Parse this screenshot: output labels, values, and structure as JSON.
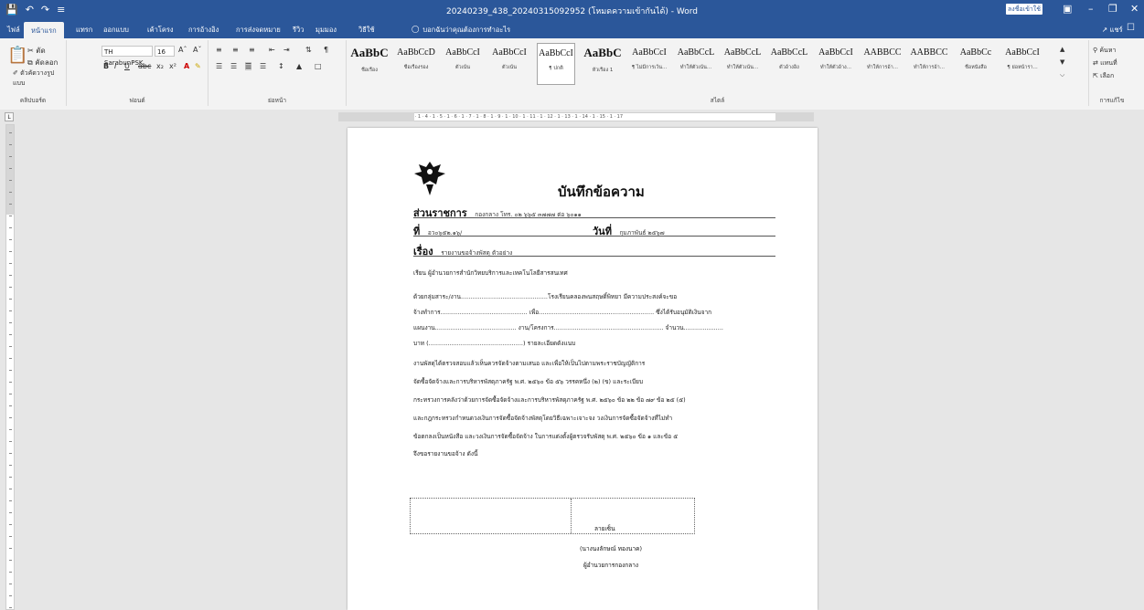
{
  "window": {
    "title": "20240239_438_20240315092952 (โหมดความเข้ากันได้) - Word",
    "signin_label": "ลงชื่อเข้าใช้",
    "save_icon": "save-icon",
    "undo_icon": "undo-icon",
    "redo_icon": "redo-icon"
  },
  "tabs": [
    {
      "label": "ไฟล์"
    },
    {
      "label": "หน้าแรก",
      "active": true
    },
    {
      "label": "แทรก"
    },
    {
      "label": "ออกแบบ"
    },
    {
      "label": "เค้าโครง"
    },
    {
      "label": "การอ้างอิง"
    },
    {
      "label": "การส่งจดหมาย"
    },
    {
      "label": "รีวิว"
    },
    {
      "label": "มุมมอง"
    },
    {
      "label": "วิธีใช้"
    }
  ],
  "tell_me": "บอกฉันว่าคุณต้องการทำอะไร",
  "share_label": "แชร์",
  "ribbon": {
    "clipboard": {
      "cut": "ตัด",
      "copy": "คัดลอก",
      "painter": "ตัวคัดวางรูปแบบ",
      "label": "คลิปบอร์ด"
    },
    "font": {
      "name": "TH SarabunPSK",
      "size": "16",
      "label": "ฟอนต์"
    },
    "paragraph": {
      "label": "ย่อหน้า"
    },
    "styles": {
      "label": "สไตล์",
      "items": [
        {
          "sample": "AaBbC",
          "name": "ชื่อเรื่อง",
          "big": true
        },
        {
          "sample": "AaBbCcD",
          "name": "ชื่อเรื่องรอง"
        },
        {
          "sample": "AaBbCcI",
          "name": "ตัวเน้น"
        },
        {
          "sample": "AaBbCcI",
          "name": "ตัวเน้น"
        },
        {
          "sample": "AaBbCcI",
          "name": "¶ ปกติ",
          "selected": true
        },
        {
          "sample": "AaBbC",
          "name": "หัวเรื่อง 1",
          "big": true
        },
        {
          "sample": "AaBbCcI",
          "name": "¶ ไม่มีการเว้น..."
        },
        {
          "sample": "AaBbCcL",
          "name": "ทำให้ตัวเน้น..."
        },
        {
          "sample": "AaBbCcL",
          "name": "ทำให้ตัวเน้น..."
        },
        {
          "sample": "AaBbCcL",
          "name": "ตัวอ้างอิง"
        },
        {
          "sample": "AaBbCcI",
          "name": "ทำให้ตัวอ้าง..."
        },
        {
          "sample": "AABBCC",
          "name": "ทำให้การอ้า..."
        },
        {
          "sample": "AABBCC",
          "name": "ทำให้การอ้า..."
        },
        {
          "sample": "AaBbCc",
          "name": "ชื่อหนังสือ"
        },
        {
          "sample": "AaBbCcI",
          "name": "¶ ย่อหน้ารา..."
        }
      ]
    },
    "editing": {
      "find": "ค้นหา",
      "replace": "แทนที่",
      "select": "เลือก",
      "label": "การแก้ไข"
    }
  },
  "ruler_text": "1 · 2 · 1 · 1 · · · 1 · 1 · 1 · 2 · 1 · 3 · 1 · 4 · 1 · 5 · 1 · 6 · 1 · 7 · 1 · 8 · 1 · 9 · 1 · 10 · 1 · 11 · 1 · 12 · 1 · 13 · 1 · 14 · 1 · 15 · 1 · 17",
  "document": {
    "memo_title": "บันทึกข้อความ",
    "dept_label": "ส่วนราชการ",
    "dept_value": "กองกลาง  โทร. ๐๒ ๖๖๕ ๓๗๗๗ ต่อ ๖๐๑๑",
    "ref_label": "ที่",
    "ref_value": "อว๐๖๕๒.๑๖/",
    "date_label": "วันที่",
    "date_value": "กุมภาพันธ์ ๒๕๖๗",
    "subject_label": "เรื่อง",
    "subject_value": "รายงานขอจ้างพัสดุ ตัวอย่าง",
    "to_line": "เรียน  ผู้อำนวยการสำนักวิทยบริการและเทคโนโลยีสารสนเทศ",
    "body_lines": [
      "               ด้วยกลุ่มสาระ/งาน..............................................โรงเรียนคลองพนสฤษดิ์พิทยา มีความประสงค์จะขอ",
      "จ้างทำการ.............................................. เพื่อ............................................................. ซึ่งได้รับอนุมัติเงินจาก",
      "แผนงาน........................................... งาน/โครงการ.......................................................... จำนวน.....................",
      "บาท (..................................................) รายละเอียดดังแนบ",
      "               งานพัสดุได้ตรวจสอบแล้วเห็นควรจัดจ้างตามเสนอ และเพื่อให้เป็นไปตามพระราชบัญญัติการ",
      "จัดซื้อจัดจ้างและการบริหารพัสดุภาครัฐ พ.ศ. ๒๕๖๐ ข้อ ๕๖ วรรคหนึ่ง (๒) (ข) และระเบียบ",
      "กระทรวงการคลังว่าด้วยการจัดซื้อจัดจ้างและการบริหารพัสดุภาครัฐ พ.ศ. ๒๕๖๐ ข้อ ๒๒ ข้อ ๗๙ ข้อ ๒๕ (๕)",
      "และกฎกระทรวงกำหนดวงเงินการจัดซื้อจัดจ้างพัสดุโดยวิธีเฉพาะเจาะจง วงเงินการจัดซื้อจัดจ้างที่ไม่ทำ",
      "ข้อตกลงเป็นหนังสือ และวงเงินการจัดซื้อจัดจ้าง ในการแต่งตั้งผู้ตรวจรับพัสดุ พ.ศ. ๒๕๖๐ ข้อ ๑ และข้อ ๕",
      "จึงขอรายงานขอจ้าง ดังนี้"
    ],
    "signature_label": "ลายเซ็น",
    "signer_name": "(นางนงลักษณ์ ทองนาค)",
    "signer_position": "ผู้อำนวยการกองกลาง"
  }
}
